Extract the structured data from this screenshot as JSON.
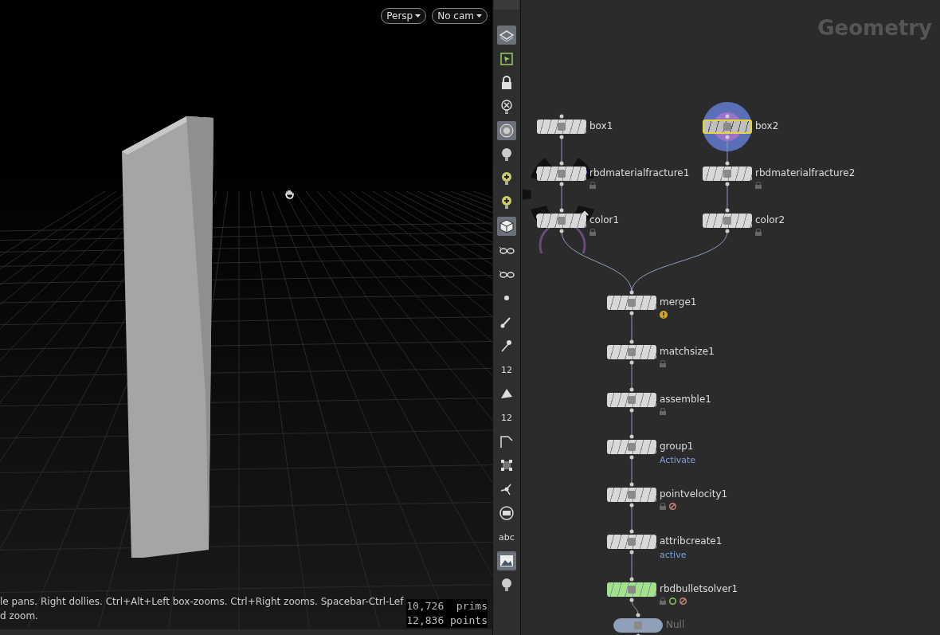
{
  "viewport": {
    "camera_menus": [
      {
        "label": "Persp"
      },
      {
        "label": "No cam"
      }
    ],
    "status_lines": [
      "le pans. Right dollies. Ctrl+Alt+Left box-zooms. Ctrl+Right zooms. Spacebar-Ctrl-Lef",
      "d zoom."
    ],
    "stats": [
      "10,726  prims",
      "12,836 points"
    ]
  },
  "toolbar": [
    {
      "kind": "layers",
      "selected": true
    },
    {
      "kind": "select",
      "selected": false
    },
    {
      "kind": "lock",
      "selected": false
    },
    {
      "kind": "bulb-x",
      "selected": false
    },
    {
      "kind": "ghost",
      "selected": true
    },
    {
      "kind": "bulb",
      "selected": false
    },
    {
      "kind": "bulb-plus",
      "selected": false
    },
    {
      "kind": "bulb-plus",
      "selected": false
    },
    {
      "kind": "cube",
      "selected": true
    },
    {
      "kind": "glasses",
      "selected": false
    },
    {
      "kind": "glasses",
      "selected": false
    },
    {
      "kind": "dot",
      "selected": false
    },
    {
      "kind": "brush",
      "selected": false
    },
    {
      "kind": "pin",
      "selected": false
    },
    {
      "kind": "text",
      "label": "12",
      "selected": false
    },
    {
      "kind": "flag",
      "selected": false
    },
    {
      "kind": "text",
      "label": "12",
      "selected": false
    },
    {
      "kind": "corner",
      "selected": false
    },
    {
      "kind": "grid",
      "selected": false
    },
    {
      "kind": "joint",
      "selected": false
    },
    {
      "kind": "circle",
      "selected": false
    },
    {
      "kind": "text",
      "label": "abc",
      "selected": false
    },
    {
      "kind": "image",
      "selected": true
    },
    {
      "kind": "bulb",
      "selected": false
    }
  ],
  "network": {
    "title": "Geometry",
    "nodes": [
      {
        "name": "box1",
        "selected": false,
        "display": false
      },
      {
        "name": "rbdmaterialfracture1",
        "selected": false,
        "display": false,
        "badges": [
          {
            "kind": "lock"
          }
        ]
      },
      {
        "name": "color1",
        "selected": false,
        "display": false,
        "badges": [
          {
            "kind": "lock"
          }
        ]
      },
      {
        "name": "box2",
        "selected": true,
        "display": false
      },
      {
        "name": "rbdmaterialfracture2",
        "selected": false,
        "display": false,
        "badges": [
          {
            "kind": "lock"
          }
        ]
      },
      {
        "name": "color2",
        "selected": false,
        "display": false,
        "badges": [
          {
            "kind": "lock"
          }
        ]
      },
      {
        "name": "merge1",
        "selected": false,
        "display": false,
        "badges": [
          {
            "kind": "warning"
          }
        ]
      },
      {
        "name": "matchsize1",
        "selected": false,
        "display": false,
        "badges": [
          {
            "kind": "lock"
          }
        ]
      },
      {
        "name": "assemble1",
        "selected": false,
        "display": false,
        "badges": [
          {
            "kind": "lock"
          }
        ]
      },
      {
        "name": "group1",
        "selected": false,
        "display": false,
        "comment": "Activate"
      },
      {
        "name": "pointvelocity1",
        "selected": false,
        "display": false,
        "badges": [
          {
            "kind": "lock"
          },
          {
            "kind": "bypass"
          }
        ]
      },
      {
        "name": "attribcreate1",
        "selected": false,
        "display": false,
        "comment": "active"
      },
      {
        "name": "rbdbulletsolver1",
        "selected": false,
        "display": true,
        "badges": [
          {
            "kind": "lock"
          },
          {
            "kind": "ring"
          },
          {
            "kind": "bypass"
          }
        ]
      },
      {
        "name": "Null",
        "selected": false,
        "display": false
      }
    ]
  }
}
